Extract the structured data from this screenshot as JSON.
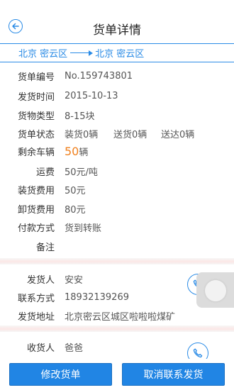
{
  "header": {
    "title": "货单详情"
  },
  "route": {
    "from": "北京 密云区",
    "to": "北京 密云区"
  },
  "details": [
    {
      "label": "货单编号",
      "value": "No.159743801"
    },
    {
      "label": "发货时间",
      "value": "2015-10-13"
    },
    {
      "label": "货物类型",
      "value": "8-15块"
    },
    {
      "label": "货单状态",
      "value_parts": [
        "装货0辆",
        "送货0辆",
        "送达0辆"
      ]
    },
    {
      "label": "剩余车辆",
      "number": "50",
      "unit": "辆"
    },
    {
      "label": "运费",
      "value": "50元/吨"
    },
    {
      "label": "装货费用",
      "value": "50元"
    },
    {
      "label": "卸货费用",
      "value": "80元"
    },
    {
      "label": "付款方式",
      "value": "货到转账"
    },
    {
      "label": "备注",
      "value": ""
    }
  ],
  "sender": {
    "name_label": "发货人",
    "name": "安安",
    "phone_label": "联系方式",
    "phone": "18932139269",
    "address_label": "发货地址",
    "address": "北京密云区城区啦啦啦煤矿"
  },
  "receiver": {
    "name_label": "收货人",
    "name": "爸爸"
  },
  "footer": {
    "edit_label": "修改货单",
    "cancel_label": "取消联系发货"
  },
  "colors": {
    "accent": "#2a8be6",
    "button": "#2185e4",
    "highlight": "#f0801e"
  }
}
